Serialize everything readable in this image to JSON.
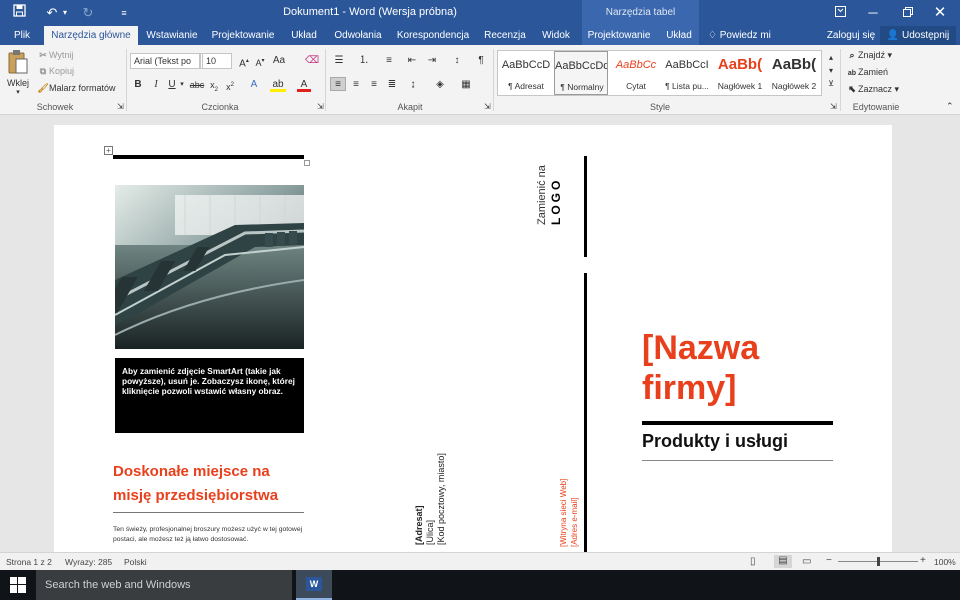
{
  "titlebar": {
    "title": "Dokument1 - Word (Wersja próbna)",
    "context_title": "Narzędzia tabel"
  },
  "tabs": [
    "Plik",
    "Narzędzia główne",
    "Wstawianie",
    "Projektowanie",
    "Układ",
    "Odwołania",
    "Korespondencja",
    "Recenzja",
    "Widok",
    "Projektowanie",
    "Układ"
  ],
  "tell_me": "Powiedz mi",
  "signin": "Zaloguj się",
  "share": "Udostępnij",
  "clipboard": {
    "paste": "Wklej",
    "cut": "Wytnij",
    "copy": "Kopiuj",
    "painter": "Malarz formatów",
    "label": "Schowek"
  },
  "font": {
    "name": "Arial (Tekst po",
    "size": "10",
    "label": "Czcionka"
  },
  "paragraph": {
    "label": "Akapit"
  },
  "styles": {
    "label": "Style",
    "items": [
      {
        "preview": "AaBbCcD",
        "name": "¶ Adresat"
      },
      {
        "preview": "AaBbCcDd",
        "name": "¶ Normalny"
      },
      {
        "preview": "AaBbCc",
        "name": "Cytat"
      },
      {
        "preview": "AaBbCcI",
        "name": "¶ Lista pu..."
      },
      {
        "preview": "AaBb(",
        "name": "Nagłówek 1"
      },
      {
        "preview": "AaBb(",
        "name": "Nagłówek 2"
      }
    ]
  },
  "editing": {
    "find": "Znajdź",
    "replace": "Zamień",
    "select": "Zaznacz",
    "label": "Edytowanie"
  },
  "doc": {
    "caption": "Aby zamienić zdjęcie SmartArt (takie jak powyższe), usuń je. Zobaczysz ikonę, której kliknięcie pozwoli wstawić własny obraz.",
    "heading": "Doskonałe miejsce na misję przedsiębiorstwa",
    "body": "Ten świeży, profesjonalnej broszury możesz użyć w tej gotowej postaci, ale możesz też ją łatwo dostosować.",
    "addr1": "[Adresat]",
    "addr2": "[Ulica]",
    "addr3": "[Kod pocztowy, miasto]",
    "web": "[Witryna sieci Web]",
    "email": "[Adres e-mail]",
    "logo_small": "Zamienić na",
    "logo_big": "LOGO",
    "company": "[Nazwa firmy]",
    "tagline": "Produkty i usługi"
  },
  "status": {
    "page": "Strona 1 z 2",
    "words": "Wyrazy: 285",
    "lang": "Polski",
    "zoom": "100%",
    "zoom_level": 0.5
  },
  "taskbar": {
    "search": "Search the web and Windows"
  },
  "colors": {
    "accent": "#2b579a",
    "red": "#e8401c"
  }
}
